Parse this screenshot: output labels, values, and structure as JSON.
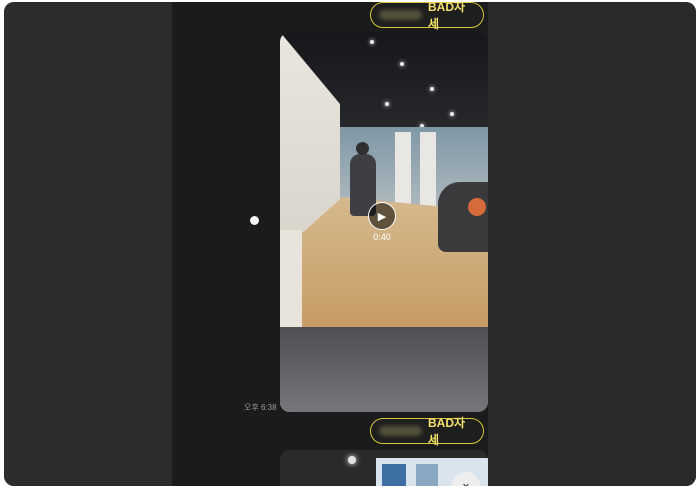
{
  "messages": [
    {
      "sender_tag": "BAD자세"
    },
    {
      "sender_tag": "BAD자세"
    }
  ],
  "video": {
    "duration": "0:40",
    "play_icon": "play-icon",
    "sent_time": "오후 6:38"
  },
  "icons": {
    "scroll_down": "chevron-down-icon"
  },
  "colors": {
    "accent": "#d6c43a",
    "chat_bg": "#1b1b1b",
    "side_bg": "#2c2c2c"
  }
}
